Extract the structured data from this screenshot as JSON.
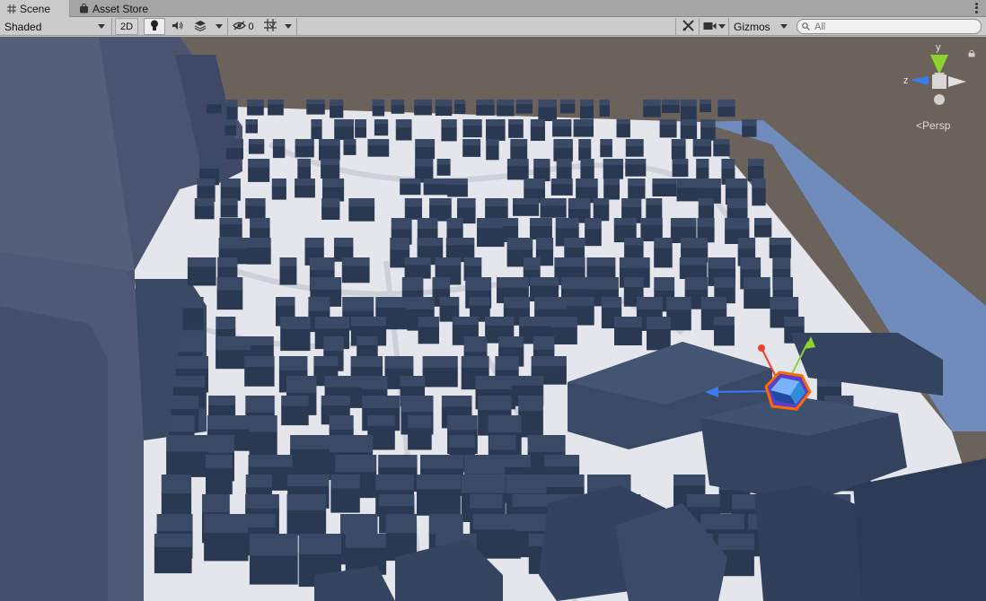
{
  "tabs": [
    {
      "label": "Scene",
      "icon": "hash-icon",
      "active": true
    },
    {
      "label": "Asset Store",
      "icon": "bag-icon",
      "active": false
    }
  ],
  "toolbar": {
    "shading_mode": "Shaded",
    "mode_2d": "2D",
    "hidden_count": "0",
    "gizmos_label": "Gizmos",
    "search_placeholder": "All"
  },
  "scene_gizmo": {
    "axis_y": "y",
    "axis_z": "z",
    "projection": "Persp"
  },
  "colors": {
    "sky": "#6b625b",
    "ground": "#e4e6ec",
    "buildings_top": "#3a4a66",
    "buildings_side": "#2b3852",
    "water": "#6f8cbc",
    "selection_outline": "#ff6a00",
    "axis_x": "#e8432b",
    "axis_y": "#8fd12f",
    "axis_z": "#3a7cf0"
  }
}
